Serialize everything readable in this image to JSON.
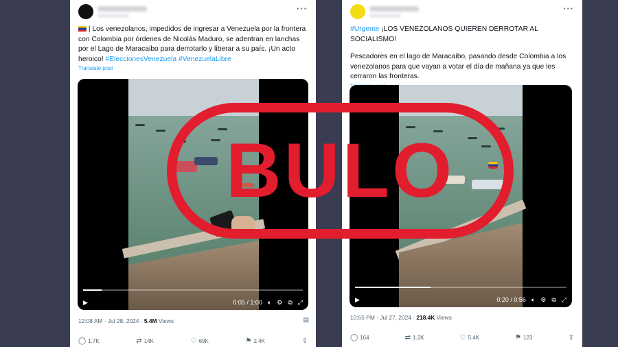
{
  "tweet1": {
    "avatar_color": "#111111",
    "flag_icon": "venezuela-flag-icon",
    "text_part1": "| Los venezolanos, impedidos de ingresar a Venezuela por la frontera con Colombia por órdenes de Nicolás Maduro, se adentran en lanchas por el Lago de Maracaibo para derrotarlo y liberar a su país. ¡Un acto heroico! ",
    "hashtag1": "#EleccionesVenezuela",
    "hashtag2": "#VenezuelaLibre",
    "translate": "Translate post",
    "video_time": "0:05 / 1:00",
    "video_progress": 0.083,
    "timestamp": "12:08 AM · Jul 28, 2024 · ",
    "views": "5.4M",
    "views_label": " Views",
    "replies": "1.7K",
    "reposts": "14K",
    "likes": "69K",
    "bookmarks": "2.4K"
  },
  "tweet2": {
    "avatar_color": "#f4dc15",
    "hashtag": "#Urgente",
    "headline": " ¡LOS VENEZOLANOS QUIEREN DERROTAR AL SOCIALISMO!",
    "text": "Pescadores en el lago de Maracaibo, pasando desde Colombia a los venezolanos para que vayan a votar el día de mañana ya que les cerraron las fronteras.",
    "translate": "Translate post",
    "video_time": "0:20 / 0:56",
    "video_progress": 0.357,
    "timestamp": "10:55 PM · Jul 27, 2024 · ",
    "views": "218.4K",
    "views_label": " Views",
    "replies": "164",
    "reposts": "1.2K",
    "likes": "5.4K",
    "bookmarks": "123"
  },
  "stamp": {
    "label": "BULO",
    "color": "#e11d2e"
  }
}
